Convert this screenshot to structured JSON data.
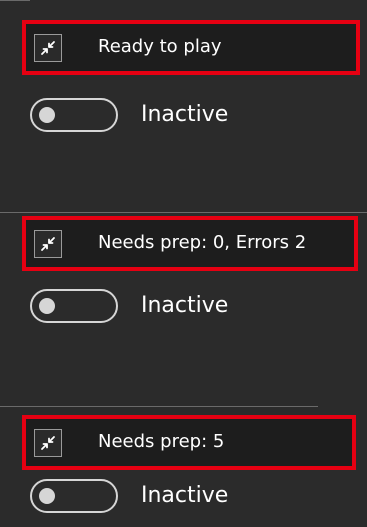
{
  "colors": {
    "background": "#2b2b2b",
    "highlight_border": "#e60012",
    "status_box_background": "#1d1d1d",
    "divider": "#6a6a6a",
    "toggle": "#d6d6d6",
    "text": "#ffffff"
  },
  "items": [
    {
      "icon": "collapse-arrows-icon",
      "status": "Ready to play",
      "toggle_label": "Inactive",
      "toggle_on": false
    },
    {
      "icon": "collapse-arrows-icon",
      "status": "Needs prep: 0, Errors 2",
      "toggle_label": "Inactive",
      "toggle_on": false
    },
    {
      "icon": "collapse-arrows-icon",
      "status": "Needs prep: 5",
      "toggle_label": "Inactive",
      "toggle_on": false
    }
  ]
}
